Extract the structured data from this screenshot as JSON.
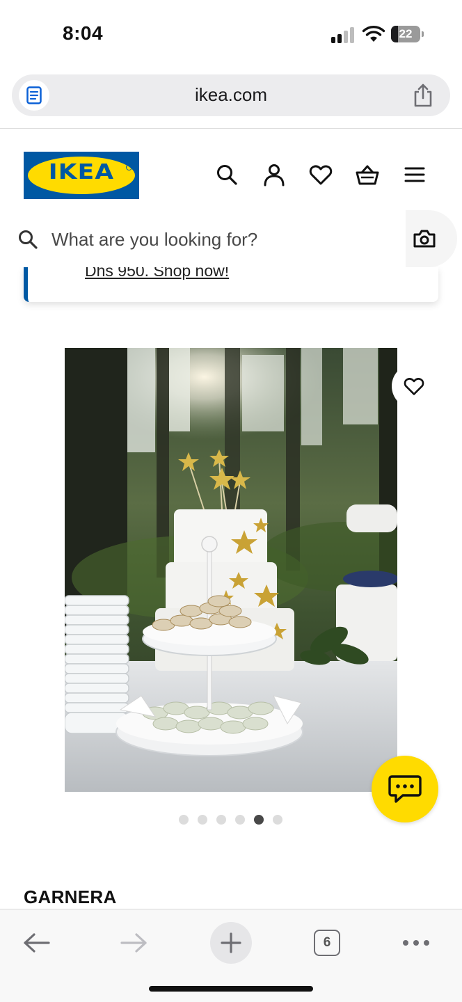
{
  "status_bar": {
    "time": "8:04",
    "battery_level": "22",
    "icons": [
      "cellular-signal-icon",
      "wifi-icon",
      "battery-icon"
    ]
  },
  "browser": {
    "url": "ikea.com",
    "icons": [
      "reader-mode-icon",
      "share-icon"
    ]
  },
  "header": {
    "logo_text": "IKEA",
    "icons": [
      "search-icon",
      "profile-icon",
      "heart-icon",
      "shopping-basket-icon",
      "menu-icon"
    ]
  },
  "search": {
    "placeholder": "What are you looking for?",
    "icons": [
      "search-icon",
      "camera-icon"
    ]
  },
  "promo": {
    "text": "Dhs 950. Shop now!"
  },
  "product": {
    "image_alt": "GARNERA serving stand with macarons in front of a star-decorated cake in a forest",
    "carousel": {
      "total": 6,
      "active_index": 4
    },
    "name": "GARNERA",
    "icons": [
      "heart-icon",
      "chat-icon"
    ]
  },
  "toolbar": {
    "tab_count": "6",
    "icons": [
      "back-arrow-icon",
      "forward-arrow-icon",
      "plus-icon",
      "tabs-icon",
      "more-icon"
    ]
  },
  "colors": {
    "ikea_blue": "#0058a3",
    "ikea_yellow": "#ffdb00",
    "accent_text": "#111111",
    "toolbar_bg": "#f8f8f8"
  }
}
